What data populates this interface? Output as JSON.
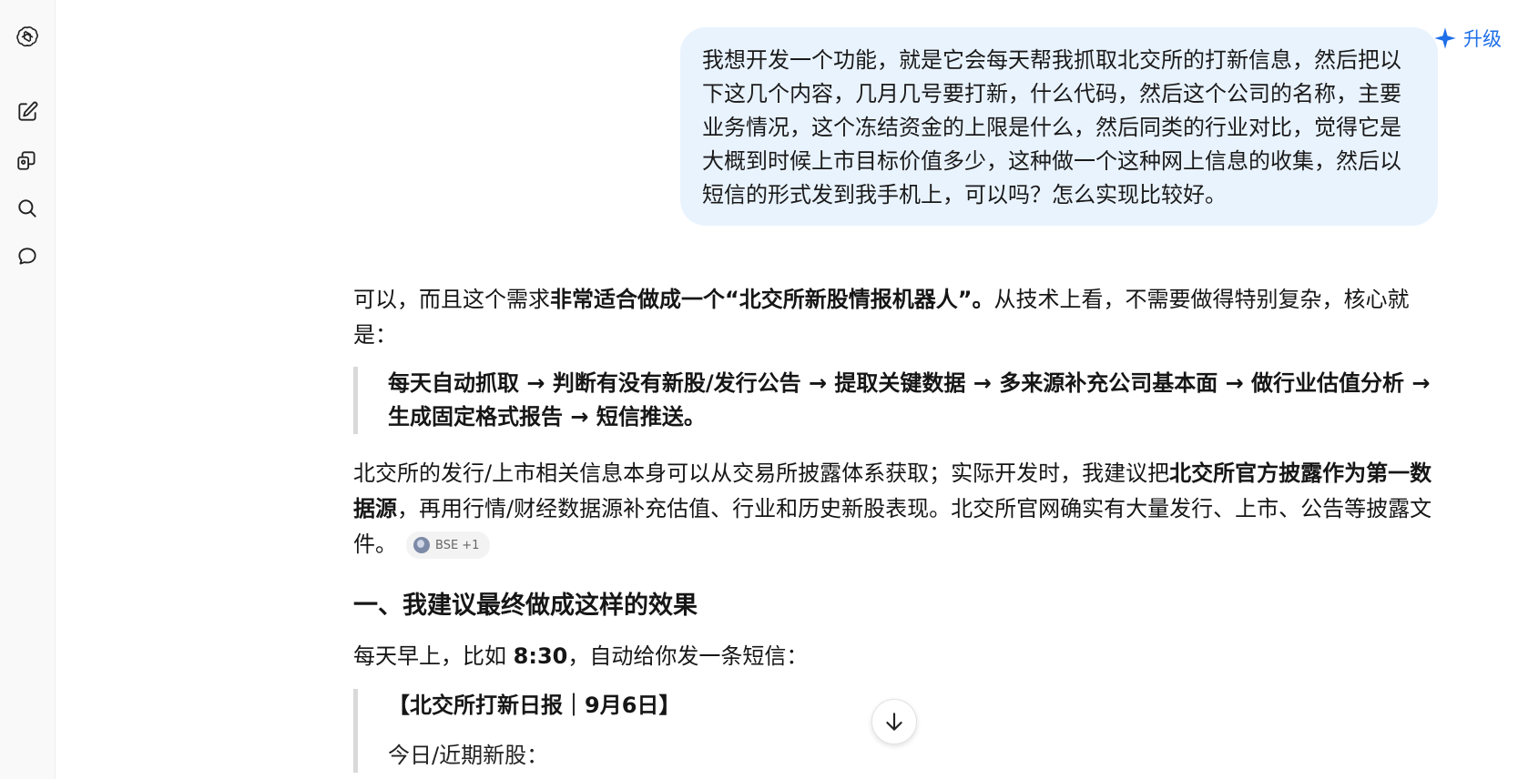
{
  "sidebar": {
    "icons": [
      "openai-logo-icon",
      "new-chat-icon",
      "library-icon",
      "search-icon",
      "chat-bubble-icon"
    ]
  },
  "header": {
    "upgrade_label": "升级"
  },
  "user_message": {
    "text": "我想开发一个功能，就是它会每天帮我抓取北交所的打新信息，然后把以下这几个内容，几月几号要打新，什么代码，然后这个公司的名称，主要业务情况，这个冻结资金的上限是什么，然后同类的行业对比，觉得它是大概到时候上市目标价值多少，这种做一个这种网上信息的收集，然后以短信的形式发到我手机上，可以吗？怎么实现比较好。"
  },
  "assistant": {
    "intro_pre": "可以，而且这个需求",
    "intro_bold": "非常适合做成一个“北交所新股情报机器人”。",
    "intro_post": "从技术上看，不需要做得特别复杂，核心就是：",
    "pipeline": "每天自动抓取 → 判断有没有新股/发行公告 → 提取关键数据 → 多来源补充公司基本面 → 做行业估值分析 → 生成固定格式报告 → 短信推送。",
    "para2_pre": "北交所的发行/上市相关信息本身可以从交易所披露体系获取；实际开发时，我建议把",
    "para2_bold": "北交所官方披露作为第一数据源",
    "para2_post": "，再用行情/财经数据源补充估值、行业和历史新股表现。北交所官网确实有大量发行、上市、公告等披露文件。",
    "citation_label": "BSE +1",
    "section_heading": "一、我建议最终做成这样的效果",
    "sms_pre": "每天早上，比如 ",
    "sms_time": "8:30",
    "sms_post": "，自动给你发一条短信：",
    "report_title": "【北交所打新日报｜9月6日】",
    "report_next": "今日/近期新股："
  }
}
